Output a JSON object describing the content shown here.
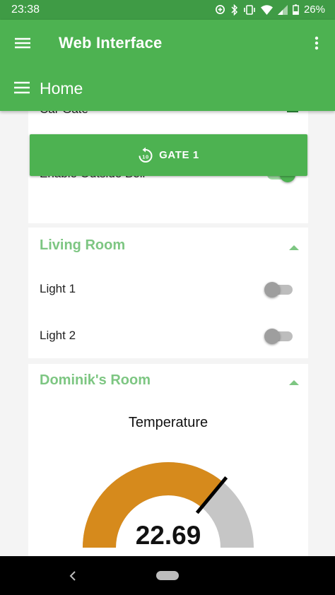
{
  "status_bar": {
    "time": "23:38",
    "battery": "26%",
    "icons": [
      "data-saver-icon",
      "bluetooth-icon",
      "vibrate-icon",
      "wifi-icon",
      "signal-icon",
      "battery-icon"
    ]
  },
  "app_bar": {
    "title": "Web Interface",
    "page_title": "Home",
    "color": "#4db251",
    "status_color": "#3f9b45"
  },
  "gate_card": {
    "partial_label": "Car Gate",
    "button_label": "GATE 1",
    "button_icon": "replay-10-icon",
    "bell_label": "Enable Outside Bell",
    "bell_on": true
  },
  "living_room": {
    "title": "Living Room",
    "lights": [
      {
        "label": "Light 1",
        "on": false
      },
      {
        "label": "Light 2",
        "on": false
      }
    ]
  },
  "dominiks_room": {
    "title": "Dominik's Room",
    "gauge": {
      "title": "Temperature",
      "value": "22.69",
      "fraction": 0.72,
      "fill_color": "#d68a1c",
      "rest_color": "#c6c6c6"
    }
  },
  "accent": "#7dc682"
}
